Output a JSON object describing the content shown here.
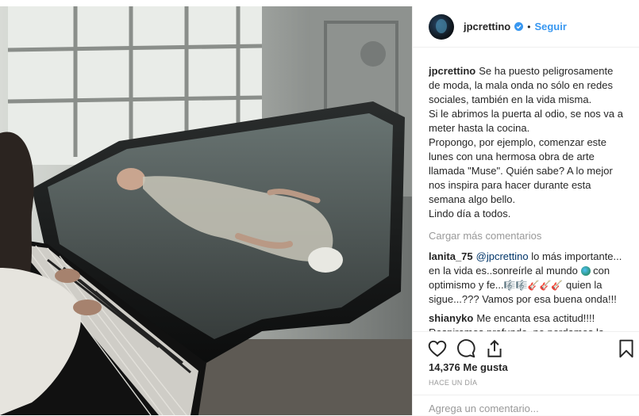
{
  "header": {
    "username": "jpcrettino",
    "separator": "•",
    "follow_label": "Seguir",
    "verified_icon": "verified-badge-icon"
  },
  "caption": {
    "username": "jpcrettino",
    "text": "Se ha puesto peligrosamente de moda, la mala onda no sólo en redes sociales, también en la vida misma.\nSi le abrimos la puerta al odio, se nos va a meter hasta la cocina.\nPropongo, por ejemplo, comenzar este lunes con una hermosa obra de arte llamada \"Muse\". Quién sabe? A lo mejor nos inspira para hacer durante esta semana algo bello.\nLindo día a todos."
  },
  "load_more_label": "Cargar más comentarios",
  "comments": [
    {
      "username": "lanita_75",
      "mention": "@jpcrettino",
      "text_1": " lo más importante... en la vida es..sonreírle al mundo ",
      "text_2": " con optimismo y fe...",
      "text_3": " quien la sigue...??? Vamos por esa buena onda!!!",
      "emoji_group": "🎼🎼🎸🎸🎸"
    },
    {
      "username": "shianyko",
      "text": "Me encanta esa actitud!!!! Respiremos profundo, no perdamos la paciencia, pongamonos en los zapatos del otro y seamos tolerantes"
    }
  ],
  "actions": {
    "like_icon": "heart-icon",
    "comment_icon": "comment-icon",
    "share_icon": "share-icon",
    "save_icon": "bookmark-icon"
  },
  "likes": {
    "count": "14,376",
    "label": "Me gusta"
  },
  "timestamp": "HACE UN DÍA",
  "add_comment_placeholder": "Agrega un comentario...",
  "colors": {
    "link": "#3897f0",
    "muted": "#999999",
    "text": "#262626",
    "border": "#efefef"
  }
}
